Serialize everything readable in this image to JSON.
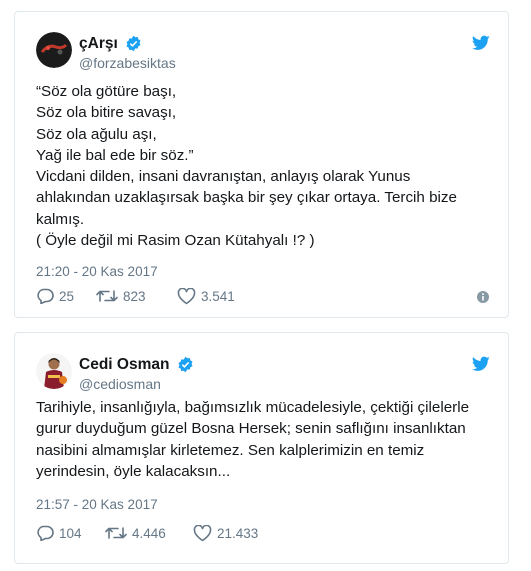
{
  "tweets": [
    {
      "display_name": "çArşı",
      "handle": "@forzabesiktas",
      "lines": [
        "“Söz ola götüre başı,",
        "Söz ola bitire savaşı,",
        "Söz ola ağulu aşı,",
        "Yağ ile bal ede bir söz.”",
        "Vicdani dilden, insani davranıştan, anlayış olarak Yunus",
        "ahlakından uzaklaşırsak başka bir şey çıkar ortaya. Tercih bize",
        "kalmış.",
        "( Öyle değil mi Rasim Ozan Kütahyalı !? )"
      ],
      "timestamp": "21:20 - 20 Kas 2017",
      "replies": "25",
      "retweets": "823",
      "likes": "3.541"
    },
    {
      "display_name": "Cedi Osman",
      "handle": "@cediosman",
      "lines": [
        "Tarihiyle, insanlığıyla, bağımsızlık mücadelesiyle, çektiği çilelerle",
        "gurur duyduğum güzel Bosna Hersek; senin saflığını insanlıktan",
        "nasibini almamışlar kirletemez. Sen kalplerimizin en temiz",
        "yerindesin, öyle kalacaksın..."
      ],
      "timestamp": "21:57 - 20 Kas 2017",
      "replies": "104",
      "retweets": "4.446",
      "likes": "21.433"
    }
  ],
  "colors": {
    "twitter_blue": "#1da1f2",
    "secondary_text": "#657786",
    "border": "#e1e8ed"
  },
  "icons": [
    "twitter-bird-icon",
    "verified-badge-icon",
    "reply-icon",
    "retweet-icon",
    "like-icon",
    "info-icon"
  ]
}
